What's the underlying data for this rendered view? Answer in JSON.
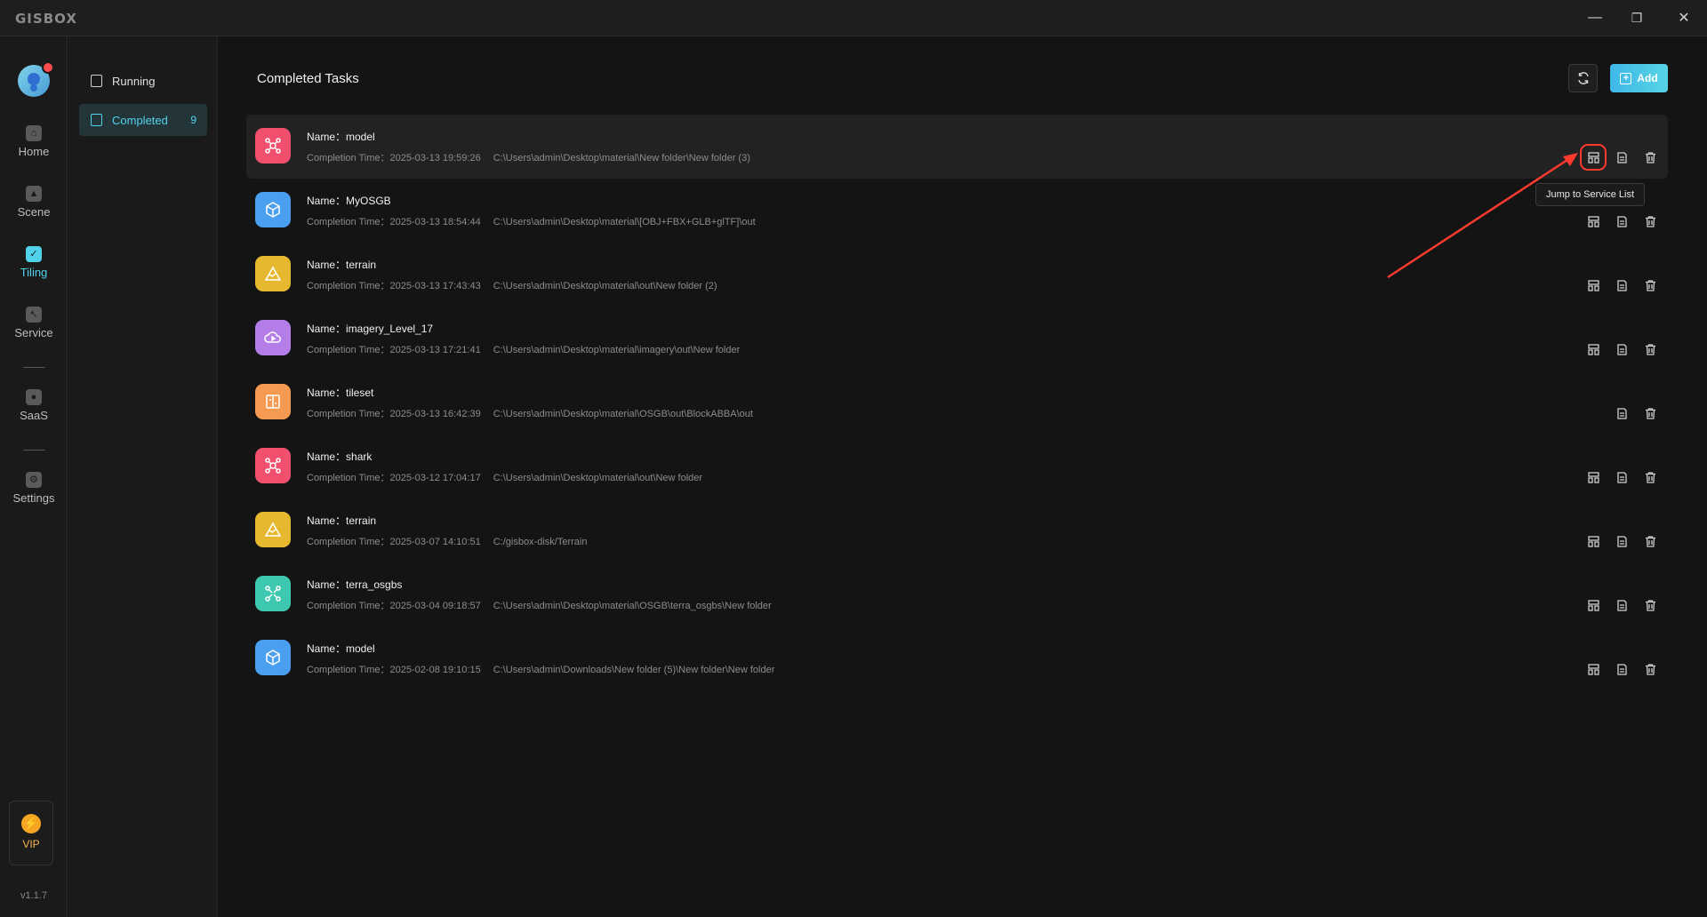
{
  "app": {
    "logo_text": "GISBOX",
    "version": "v1.1.7"
  },
  "window": {
    "minimize": "—",
    "restore": "❐",
    "close": "✕"
  },
  "rail": {
    "items": [
      {
        "label": "Home",
        "icon": "home-icon"
      },
      {
        "label": "Scene",
        "icon": "scene-icon"
      },
      {
        "label": "Tiling",
        "icon": "tiling-icon"
      },
      {
        "label": "Service",
        "icon": "service-icon"
      },
      {
        "label": "SaaS",
        "icon": "saas-icon"
      },
      {
        "label": "Settings",
        "icon": "settings-icon"
      }
    ],
    "active": "Tiling",
    "vip_label": "VIP"
  },
  "subnav": {
    "running_label": "Running",
    "completed_label": "Completed",
    "completed_count": "9"
  },
  "main": {
    "title": "Completed Tasks",
    "add_label": "Add",
    "name_prefix": "Name：",
    "time_prefix": "Completion Time：",
    "tooltip": "Jump to Service List"
  },
  "tasks": [
    {
      "name": "model",
      "time": "2025-03-13 19:59:26",
      "path": "C:\\Users\\admin\\Desktop\\material\\New folder\\New folder (3)",
      "icon": "model-icon",
      "color": "#f0506e",
      "service": true
    },
    {
      "name": "MyOSGB",
      "time": "2025-03-13 18:54:44",
      "path": "C:\\Users\\admin\\Desktop\\material\\[OBJ+FBX+GLB+glTF]\\out",
      "icon": "cube-icon",
      "color": "#4a9ff0",
      "service": true
    },
    {
      "name": "terrain",
      "time": "2025-03-13 17:43:43",
      "path": "C:\\Users\\admin\\Desktop\\material\\out\\New folder (2)",
      "icon": "terrain-icon",
      "color": "#e6b830",
      "service": true
    },
    {
      "name": "imagery_Level_17",
      "time": "2025-03-13 17:21:41",
      "path": "C:\\Users\\admin\\Desktop\\material\\imagery\\out\\New folder",
      "icon": "imagery-icon",
      "color": "#b57de8",
      "service": true
    },
    {
      "name": "tileset",
      "time": "2025-03-13 16:42:39",
      "path": "C:\\Users\\admin\\Desktop\\material\\OSGB\\out\\BlockABBA\\out",
      "icon": "tileset-icon",
      "color": "#f59a50",
      "service": false
    },
    {
      "name": "shark",
      "time": "2025-03-12 17:04:17",
      "path": "C:\\Users\\admin\\Desktop\\material\\out\\New folder",
      "icon": "model-icon",
      "color": "#f0506e",
      "service": true
    },
    {
      "name": "terrain",
      "time": "2025-03-07 14:10:51",
      "path": "C:/gisbox-disk/Terrain",
      "icon": "terrain-icon",
      "color": "#e6b830",
      "service": true
    },
    {
      "name": "terra_osgbs",
      "time": "2025-03-04 09:18:57",
      "path": "C:\\Users\\admin\\Desktop\\material\\OSGB\\terra_osgbs\\New folder",
      "icon": "osgb-icon",
      "color": "#3fc8b0",
      "service": true
    },
    {
      "name": "model",
      "time": "2025-02-08 19:10:15",
      "path": "C:\\Users\\admin\\Downloads\\New folder (5)\\New folder\\New folder",
      "icon": "cube-icon",
      "color": "#4a9ff0",
      "service": true
    }
  ]
}
